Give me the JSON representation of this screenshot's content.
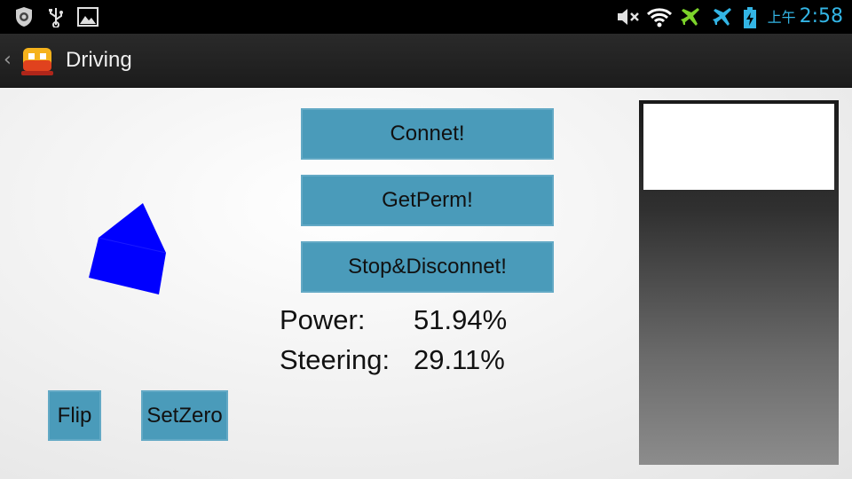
{
  "status_bar": {
    "ampm": "上午",
    "time": "2:58",
    "accent": "#33b5e5",
    "icons": [
      "shield-icon",
      "usb-icon",
      "image-icon",
      "mute-icon",
      "wifi-icon",
      "airplane-icon",
      "airplane-icon",
      "battery-charging-icon"
    ]
  },
  "action_bar": {
    "title": "Driving",
    "app_icon": "car-icon"
  },
  "buttons": {
    "connect": "Connet!",
    "get_perm": "GetPerm!",
    "stop_disconnect": "Stop&Disconnet!",
    "flip": "Flip",
    "set_zero": "SetZero",
    "color": "#4a9bba"
  },
  "readouts": {
    "power_label": "Power:",
    "power_value": "51.94%",
    "steering_label": "Steering:",
    "steering_value": "29.11%"
  },
  "orientation_indicator": {
    "shape": "house-arrow-icon",
    "color": "#0000ff"
  }
}
